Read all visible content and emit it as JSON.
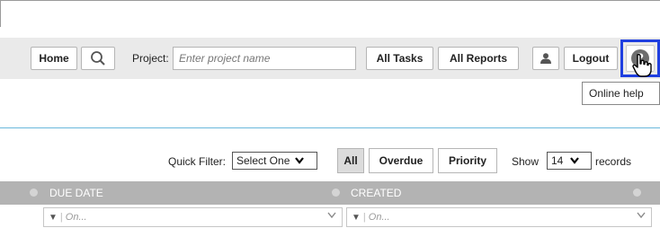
{
  "toolbar": {
    "home_label": "Home",
    "project_label": "Project:",
    "project_placeholder": "Enter project name",
    "all_tasks_label": "All Tasks",
    "all_reports_label": "All Reports",
    "logout_label": "Logout"
  },
  "tooltip": {
    "text": "Online help"
  },
  "filters": {
    "quick_filter_label": "Quick Filter:",
    "quick_filter_value": "Select One",
    "all_label": "All",
    "overdue_label": "Overdue",
    "priority_label": "Priority",
    "show_label": "Show",
    "records_value": "14",
    "records_label": "records"
  },
  "table": {
    "columns": [
      "DUE DATE",
      "CREATED"
    ],
    "filter_placeholder": "On..."
  },
  "colors": {
    "highlight": "#1f3fe0",
    "toolbar_bg": "#eaeaea",
    "header_bg": "#b3b3b3",
    "divider": "#6ab8dc"
  },
  "icons": [
    "search-icon",
    "user-icon",
    "help-icon",
    "hand-pointer-cursor-icon",
    "chevron-down-icon",
    "funnel-icon"
  ]
}
